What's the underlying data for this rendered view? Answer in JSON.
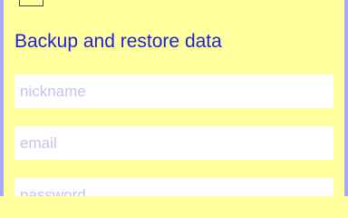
{
  "colors": {
    "background": "#ffff9e",
    "edge": "#a9a8ff",
    "title": "#1f1fd8",
    "placeholder": "#c3c3ef",
    "field_bg": "#ffffff"
  },
  "header": {
    "icon": "checkbox-icon",
    "title": "Backup and restore data"
  },
  "form": {
    "nickname": {
      "value": "",
      "placeholder": "nickname"
    },
    "email": {
      "value": "",
      "placeholder": "email"
    },
    "password": {
      "value": "",
      "placeholder": "password"
    }
  }
}
